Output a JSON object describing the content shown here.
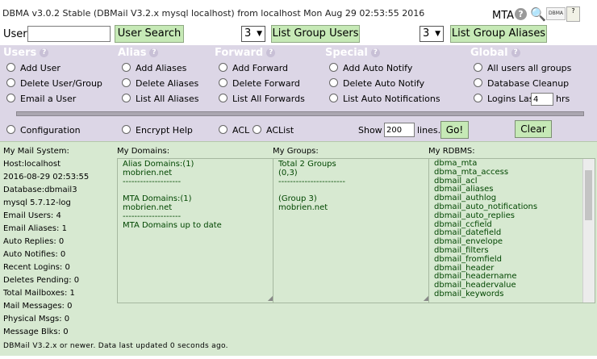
{
  "window": {
    "title": "DBMA v3.0.2 Stable (DBMail V3.2.x mysql localhost) from localhost Mon Aug 29 02:53:55 2016",
    "mta_label": "MTA",
    "dbma_badge": "DBMA"
  },
  "user_search": {
    "label": "User",
    "value": "",
    "search_button": "User Search",
    "group_count_1": "3",
    "list_groups_button": "List Group Users",
    "group_count_2": "3",
    "list_aliases_button": "List Group Aliases"
  },
  "sections": {
    "users": {
      "title": "Users",
      "items": [
        "Add User",
        "Delete User/Group",
        "Email a User"
      ]
    },
    "alias": {
      "title": "Alias",
      "items": [
        "Add Aliases",
        "Delete Aliases",
        "List All Aliases"
      ]
    },
    "forward": {
      "title": "Forward",
      "items": [
        "Add Forward",
        "Delete Forward",
        "List All Forwards"
      ]
    },
    "special": {
      "title": "Special",
      "items": [
        "Add Auto Notify",
        "Delete Auto Notify",
        "List Auto Notifications"
      ]
    },
    "global": {
      "title": "Global",
      "items": [
        "All users all groups",
        "Database Cleanup",
        "Logins Last"
      ],
      "logins_last_value": "4",
      "logins_last_unit": "hrs"
    }
  },
  "config_row": {
    "configuration": "Configuration",
    "encrypt_help": "Encrypt Help",
    "acl": "ACL",
    "aclist": "ACList",
    "show_label": "Show",
    "show_value": "200",
    "lines_label": "lines.",
    "go_button": "Go!",
    "clear_button": "Clear"
  },
  "info": {
    "system_header": "My Mail System:",
    "stats": [
      "Host:localhost",
      "2016-08-29 02:53:55",
      "Database:dbmail3",
      "mysql 5.7.12-log",
      "Email Users: 4",
      "Email Aliases: 1",
      "Auto Replies: 0",
      "Auto Notifies: 0",
      "Recent Logins: 0",
      "Deletes Pending: 0",
      "Total Mailboxes: 1",
      "Mail Messages: 0",
      "Physical Msgs: 0",
      "Message Blks: 0"
    ],
    "domains_header": "My Domains:",
    "domains_lines": [
      "Alias Domains:(1)",
      "mobrien.net",
      "--------------------",
      "",
      "MTA Domains:(1)",
      "mobrien.net",
      "--------------------",
      "MTA Domains up to date"
    ],
    "groups_header": "My Groups:",
    "groups_lines": [
      "Total 2 Groups",
      "(0,3)",
      "-----------------------",
      "",
      "(Group 3)",
      "mobrien.net"
    ],
    "rdbms_header": "My RDBMS:",
    "rdbms_lines": [
      "dbma_mta",
      "dbma_mta_access",
      "dbmail_acl",
      "dbmail_aliases",
      "dbmail_authlog",
      "dbmail_auto_notifications",
      "dbmail_auto_replies",
      "dbmail_ccfield",
      "dbmail_datefield",
      "dbmail_envelope",
      "dbmail_filters",
      "dbmail_fromfield",
      "dbmail_header",
      "dbmail_headername",
      "dbmail_headervalue",
      "dbmail_keywords"
    ],
    "footer": "DBMail V3.2.x or newer. Data last updated 0 seconds ago."
  }
}
